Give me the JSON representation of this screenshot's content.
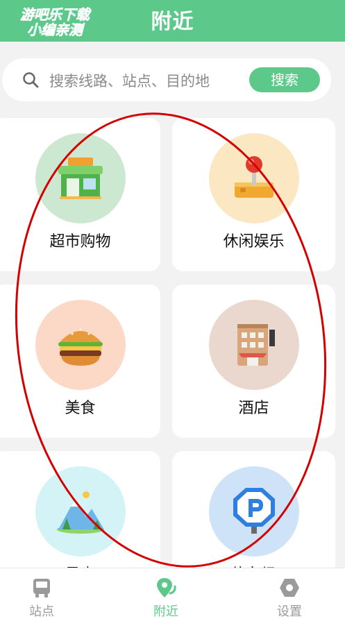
{
  "header": {
    "title": "附近",
    "accent": "#5cc98a"
  },
  "watermark": {
    "line1": "游吧乐下载",
    "line2": "小编亲测"
  },
  "search": {
    "placeholder": "搜索线路、站点、目的地",
    "button_label": "搜索",
    "icon": "search-icon"
  },
  "categories": [
    {
      "label": "超市购物",
      "icon": "supermarket-icon",
      "color": "#cde8d1"
    },
    {
      "label": "休闲娱乐",
      "icon": "joystick-icon",
      "color": "#fbe8c2"
    },
    {
      "label": "美食",
      "icon": "burger-icon",
      "color": "#fcd9c6"
    },
    {
      "label": "酒店",
      "icon": "hotel-icon",
      "color": "#ead8cf"
    },
    {
      "label": "景点",
      "icon": "mountain-icon",
      "color": "#d4f3f6"
    },
    {
      "label": "停车场",
      "icon": "parking-icon",
      "color": "#cfe3f8"
    }
  ],
  "tabbar": [
    {
      "label": "站点",
      "icon": "bus-icon",
      "active": false
    },
    {
      "label": "附近",
      "icon": "location-icon",
      "active": true
    },
    {
      "label": "设置",
      "icon": "settings-icon",
      "active": false
    }
  ],
  "annotation": {
    "color": "#d40000"
  }
}
